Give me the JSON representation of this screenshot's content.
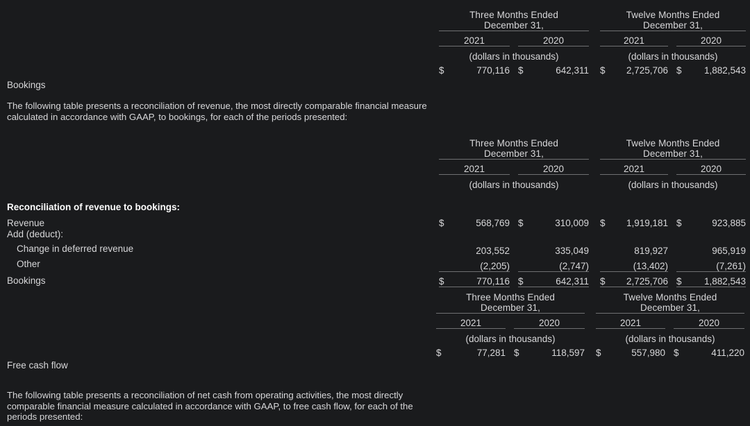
{
  "document": {
    "theme_bg": "#1a1b1d",
    "text_color": "#d7d7d9",
    "heading_color": "#ffffff",
    "rule_color": "#6f7072"
  },
  "bookings_row": {
    "label": "Bookings"
  },
  "paragraph_1": "The following table presents a reconciliation of revenue, the most directly comparable financial measure calculated in accordance with GAAP, to bookings, for each of the periods presented:",
  "paragraph_2": "The following table presents a reconciliation of net cash from operating activities, the most directly comparable financial measure calculated in accordance with GAAP, to free cash flow, for each of the periods presented:",
  "table1": {
    "header_three": "Three Months Ended",
    "header_twelve": "Twelve Months Ended",
    "header_date": "December 31,",
    "years": [
      "2021",
      "2020",
      "2021",
      "2020"
    ],
    "caption": "(dollars in thousands)",
    "row": {
      "values": [
        "770,116",
        "642,311",
        "2,725,706",
        "1,882,543"
      ],
      "currency": "$"
    }
  },
  "table2": {
    "header_three": "Three Months Ended",
    "header_twelve": "Twelve Months Ended",
    "header_date": "December 31,",
    "years": [
      "2021",
      "2020",
      "2021",
      "2020"
    ],
    "caption": "(dollars in thousands)",
    "section_title": "Reconciliation of revenue to bookings:",
    "rows": [
      {
        "label": "Revenue",
        "currency": "$",
        "values": [
          "568,769",
          "310,009",
          "1,919,181",
          "923,885"
        ]
      },
      {
        "label": "Add (deduct):",
        "currency": "",
        "values": [
          "",
          "",
          "",
          ""
        ]
      },
      {
        "label": "Change in deferred revenue",
        "currency": "",
        "values": [
          "203,552",
          "335,049",
          "819,927",
          "965,919"
        ]
      },
      {
        "label": "Other",
        "currency": "",
        "values": [
          "(2,205)",
          "(2,747)",
          "(13,402)",
          "(7,261)"
        ]
      },
      {
        "label": "Bookings",
        "currency": "$",
        "values": [
          "770,116",
          "642,311",
          "2,725,706",
          "1,882,543"
        ]
      }
    ]
  },
  "table3": {
    "header_three": "Three Months Ended",
    "header_twelve": "Twelve Months Ended",
    "header_date": "December 31,",
    "years": [
      "2021",
      "2020",
      "2021",
      "2020"
    ],
    "caption": "(dollars in thousands)",
    "row": {
      "label": "Free cash flow",
      "currency": "$",
      "values": [
        "77,281",
        "118,597",
        "557,980",
        "411,220"
      ]
    }
  }
}
